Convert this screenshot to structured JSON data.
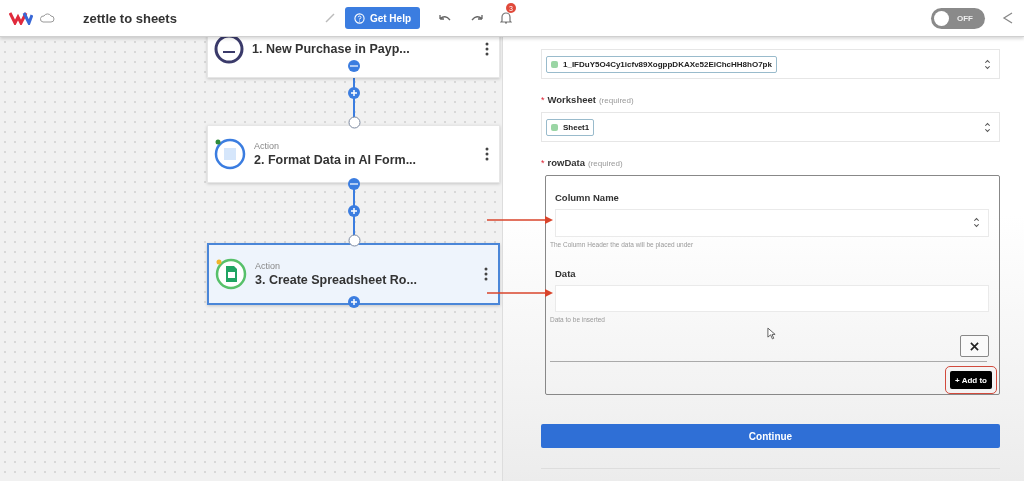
{
  "header": {
    "title": "zettle to sheets",
    "help_button": "Get Help",
    "notification_count": "3",
    "toggle": {
      "label": "OFF",
      "on": false
    }
  },
  "steps": [
    {
      "kind": "trigger",
      "title": "1. New Purchase in Payp...",
      "selected": false
    },
    {
      "kind": "ai",
      "label": "Action",
      "title": "2. Format Data in AI Form...",
      "selected": false
    },
    {
      "kind": "sheets",
      "label": "Action",
      "title": "3. Create Spreadsheet Ro...",
      "selected": true
    }
  ],
  "form": {
    "spreadsheet": {
      "value": "1_IFDuY5O4Cy1icfv89XogppDKAXe52EiChcHH8hO7pk"
    },
    "worksheet": {
      "mark": "*",
      "label": "Worksheet",
      "required": "(required)",
      "value": "Sheet1"
    },
    "row_data": {
      "mark": "*",
      "label": "rowData",
      "required": "(required)",
      "column_name": {
        "label": "Column Name",
        "hint": "The Column Header the data will be placed under"
      },
      "data": {
        "label": "Data",
        "hint": "Data to be inserted"
      },
      "add_button": "+ Add to"
    },
    "continue_button": "Continue"
  }
}
